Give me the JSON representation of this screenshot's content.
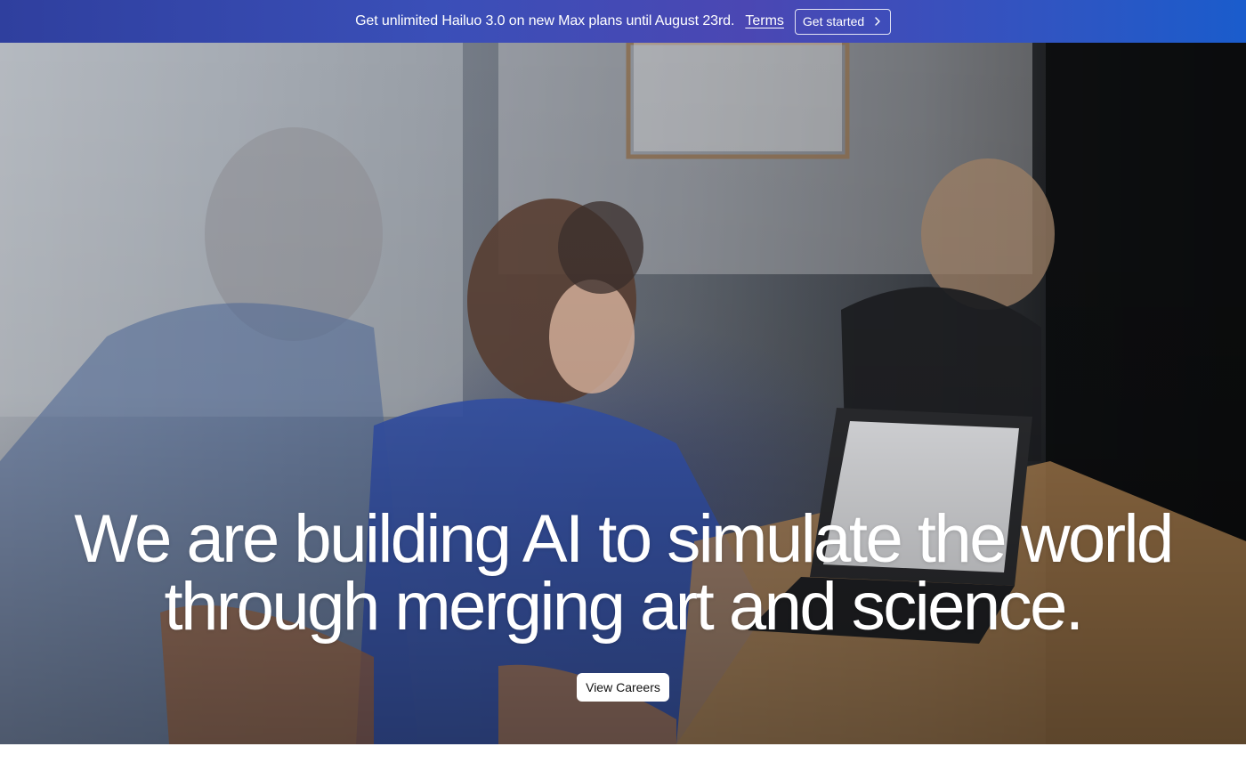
{
  "promo": {
    "text": "Get unlimited Hailuo 3.0 on new Max plans until August 23rd.",
    "terms_label": "Terms",
    "cta_label": "Get started",
    "cta_icon": "chevron-right-icon"
  },
  "hero": {
    "headline_line1": "We are building AI to simulate the world",
    "headline_line2": "through merging art and science.",
    "cta_label": "View Careers",
    "image_description_icon": "office-team-photo"
  },
  "colors": {
    "promo_gradient_start": "#2f3f9e",
    "promo_gradient_end": "#1a5ccc",
    "cta_background": "#ffffff",
    "headline_text": "#ffffff"
  }
}
